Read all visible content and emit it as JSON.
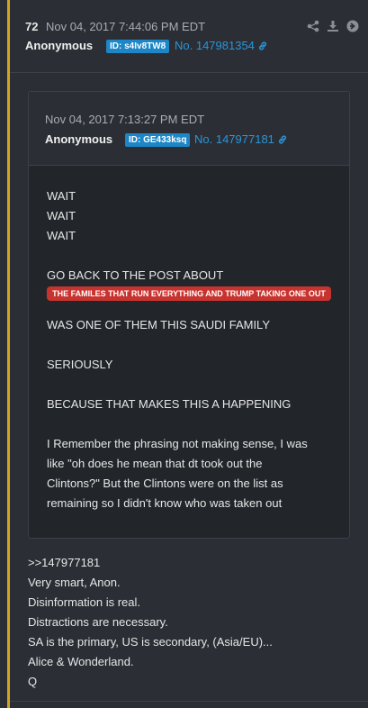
{
  "post": {
    "number": "72",
    "date": "Nov 04, 2017 7:44:06 PM EDT",
    "author": "Anonymous",
    "id": "ID: s4Iv8TW8",
    "post_no": "No. 147981354",
    "icons": [
      "share-icon",
      "download-icon",
      "goto-icon",
      "link-icon"
    ]
  },
  "quoted": {
    "date": "Nov 04, 2017 7:13:27 PM EDT",
    "author": "Anonymous",
    "id": "ID: GE433ksq",
    "post_no": "No. 147977181",
    "lines": [
      "WAIT",
      "WAIT",
      "WAIT"
    ],
    "go_back": "GO BACK TO THE POST ABOUT",
    "highlight": "THE FAMILES THAT RUN EVERYTHING AND TRUMP TAKING ONE OUT",
    "was_one": "WAS ONE OF THEM THIS SAUDI FAMILY",
    "seriously": "SERIOUSLY",
    "because": "BECAUSE THAT MAKES THIS A HAPPENING",
    "remember": [
      "I Remember the phrasing not making sense, I was",
      "like \"oh does he mean that dt took out the",
      "Clintons?\" But the Clintons were on the list as",
      "remaining so I didn't know who was taken out"
    ]
  },
  "reply": {
    "lines": [
      ">>147977181",
      "Very smart, Anon.",
      "Disinformation is real.",
      "Distractions are necessary.",
      "SA is the primary, US is secondary, (Asia/EU)...",
      "Alice & Wonderland.",
      "Q"
    ]
  },
  "colors": {
    "background": "#2b2f35",
    "accent_border": "#d1a61e",
    "id_badge": "#1c86c7",
    "link": "#2b94d8",
    "highlight": "#c7332f"
  }
}
